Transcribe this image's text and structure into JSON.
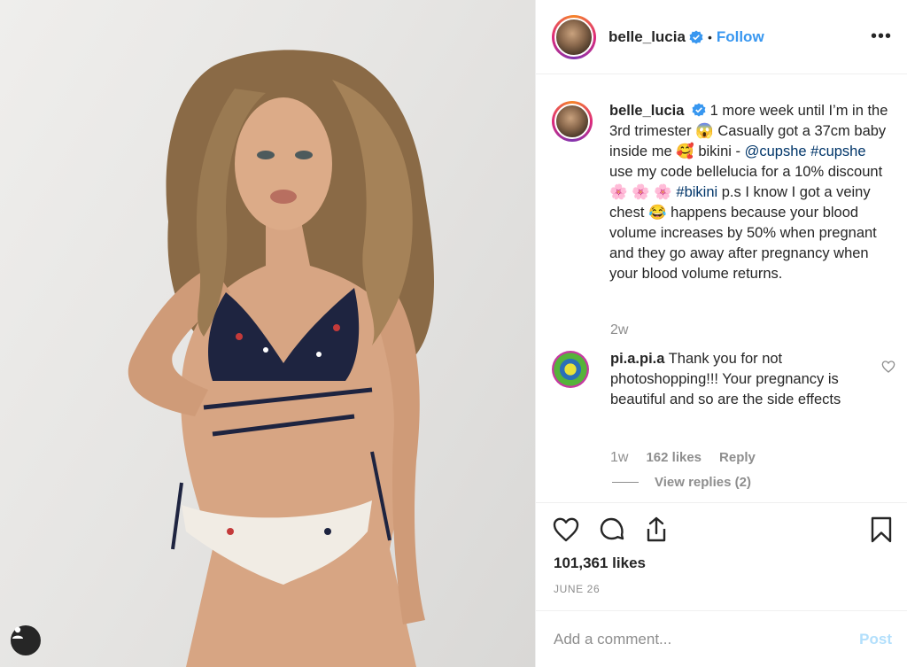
{
  "post": {
    "photo_alt": "",
    "user_tag_icon": "person-icon"
  },
  "header": {
    "username": "belle_lucia",
    "separator": "•",
    "follow_label": "Follow",
    "more_label": "•••"
  },
  "caption": {
    "username": "belle_lucia",
    "text_1": " 1 more week until I’m in the 3rd trimester 😱  Casually got a 37cm baby inside me 🥰  bikini - ",
    "mention": "@cupshe",
    "hashtag_1": "#cupshe",
    "text_2": " use my code bellelucia for a 10% discount 🌸 🌸 🌸 ",
    "hashtag_2": "#bikini",
    "text_3": " p.s I know I got a veiny chest 😂 happens because your blood volume increases by 50% when pregnant and they go away after pregnancy when your blood volume returns.",
    "age": "2w"
  },
  "comment": {
    "username": "pi.a.pi.a",
    "text": " Thank you for not photoshopping!!! Your pregnancy is beautiful and so are the side effects",
    "time": "1w",
    "likes": "162 likes",
    "reply_label": "Reply",
    "view_replies": "View replies (2)"
  },
  "actions": {
    "likes_count": "101,361 likes",
    "date": "JUNE 26"
  },
  "add_comment": {
    "placeholder": "Add a comment...",
    "post_label": "Post"
  },
  "colors": {
    "link": "#003569",
    "follow": "#3897f0",
    "muted": "#8e8e8e",
    "post_disabled": "#b2dffc"
  }
}
